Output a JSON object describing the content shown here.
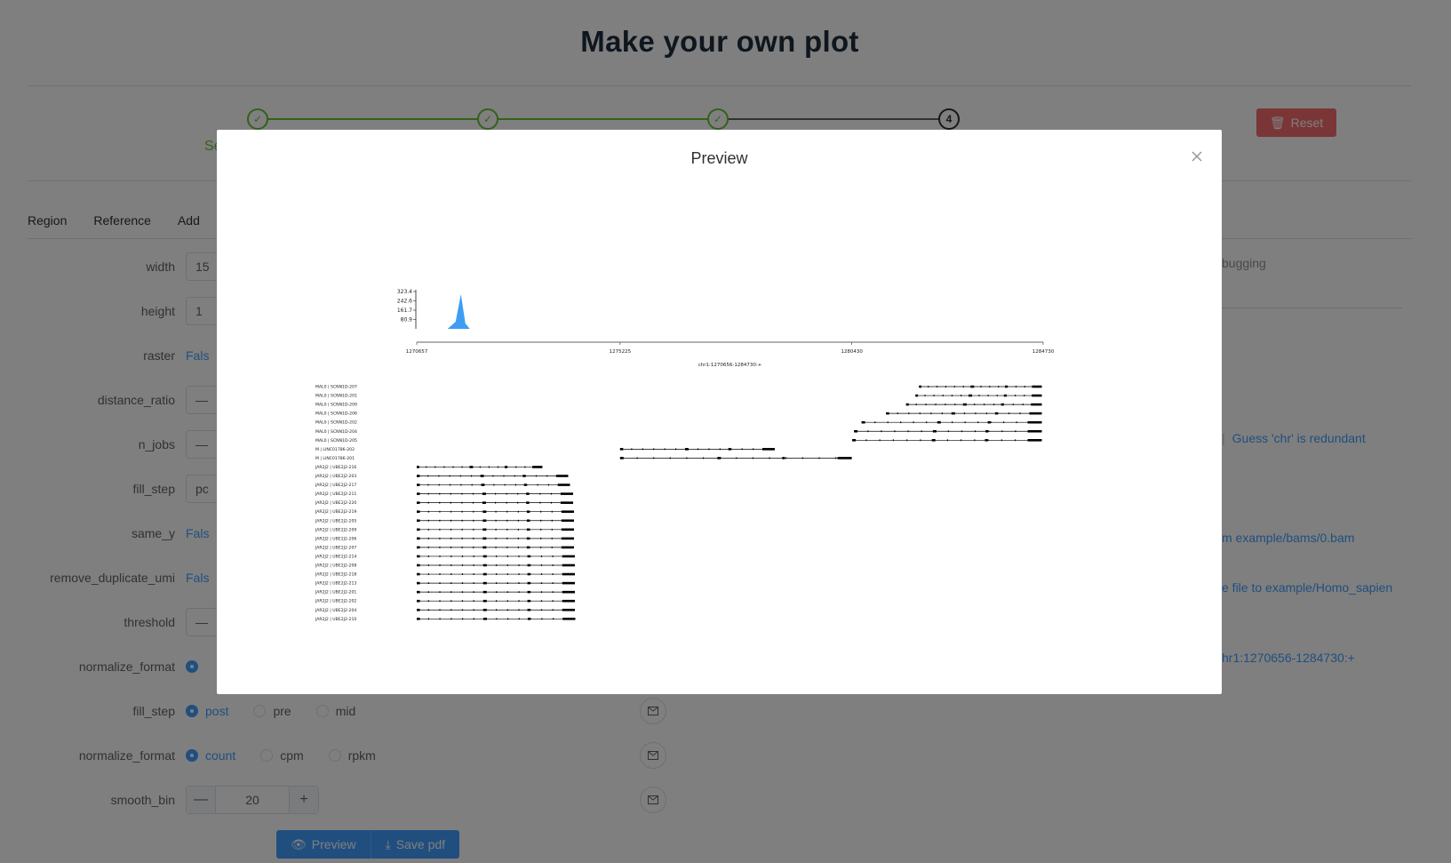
{
  "page": {
    "title": "Make your own plot",
    "step_label_partial": "Se",
    "current_step_number": "4",
    "reset_label": "Reset"
  },
  "tabs": [
    "Region",
    "Reference",
    "Add"
  ],
  "form": {
    "width": {
      "label": "width",
      "value": "15"
    },
    "height": {
      "label": "height",
      "value": "1"
    },
    "raster": {
      "label": "raster",
      "value": "Fals"
    },
    "distance_ratio": {
      "label": "distance_ratio",
      "value": "—"
    },
    "n_jobs": {
      "label": "n_jobs",
      "value": "—"
    },
    "fill_step_top": {
      "label": "fill_step",
      "value": "pc"
    },
    "same_y": {
      "label": "same_y",
      "value": "Fals"
    },
    "remove_duplicate_umi": {
      "label": "remove_duplicate_umi",
      "value": "Fals"
    },
    "threshold": {
      "label": "threshold",
      "value": "—"
    },
    "normalize_format_top": {
      "label": "normalize_format"
    },
    "fill_step": {
      "label": "fill_step",
      "options": [
        "post",
        "pre",
        "mid"
      ],
      "selected": "post"
    },
    "normalize_format": {
      "label": "normalize_format",
      "options": [
        "count",
        "cpm",
        "rpkm"
      ],
      "selected": "count"
    },
    "smooth_bin": {
      "label": "smooth_bin",
      "value": "20",
      "minus": "—",
      "plus": "+"
    }
  },
  "buttons": {
    "preview": "Preview",
    "save_pdf": "Save pdf"
  },
  "right_panel": {
    "debugging": "bugging",
    "guess_chr": "Guess 'chr' is redundant",
    "bam": "m example/bams/0.bam",
    "reference": "e file to example/Homo_sapien",
    "region": "hr1:1270656-1284730:+"
  },
  "modal": {
    "title": "Preview",
    "close_icon": "close-icon"
  },
  "chart_data": {
    "type": "area",
    "title": "",
    "xlabel": "chr1:1270656-1284730:+",
    "ylabel": "",
    "y_ticks": [
      "323.4",
      "242.6",
      "161.7",
      "80.9"
    ],
    "x_ticks": [
      "1270657",
      "1275225",
      "1280430",
      "1284730"
    ],
    "xlim": [
      1270657,
      1284730
    ],
    "ylim": [
      0,
      323.4
    ],
    "coverage_peak": {
      "x_start": 1271350,
      "x_peak": 1271650,
      "x_end": 1271850,
      "y_peak": 323.4
    },
    "transcripts": [
      {
        "name": "MAL0 | SCNN1D-207",
        "start": 1281940,
        "end": 1284700
      },
      {
        "name": "MAL0 | SCNN1D-201",
        "start": 1281860,
        "end": 1284700
      },
      {
        "name": "MAL0 | SCNN1D-209",
        "start": 1281650,
        "end": 1284700
      },
      {
        "name": "MAL0 | SCNN1D-206",
        "start": 1281200,
        "end": 1284700
      },
      {
        "name": "MAL0 | SCNN1D-202",
        "start": 1280650,
        "end": 1284700
      },
      {
        "name": "MAL0 | SCNN1D-204",
        "start": 1280480,
        "end": 1284700
      },
      {
        "name": "MAL0 | SCNN1D-205",
        "start": 1280440,
        "end": 1284700
      },
      {
        "name": "M | LINC01786-202",
        "start": 1275225,
        "end": 1278700
      },
      {
        "name": "M | LINC01786-201",
        "start": 1275225,
        "end": 1280430
      },
      {
        "name": "JAR2J2 | UBE2J2-216",
        "start": 1270657,
        "end": 1273480
      },
      {
        "name": "JAR2J2 | UBE2J2-203",
        "start": 1270657,
        "end": 1274060
      },
      {
        "name": "JAR2J2 | UBE2J2-217",
        "start": 1270657,
        "end": 1274100
      },
      {
        "name": "JAR2J2 | UBE2J2-211",
        "start": 1270657,
        "end": 1274170
      },
      {
        "name": "JAR2J2 | UBE2J2-220",
        "start": 1270657,
        "end": 1274170
      },
      {
        "name": "JAR2J2 | UBE2J2-219",
        "start": 1270657,
        "end": 1274190
      },
      {
        "name": "JAR2J2 | UBE2J2-205",
        "start": 1270657,
        "end": 1274190
      },
      {
        "name": "JAR2J2 | UBE2J2-209",
        "start": 1270657,
        "end": 1274190
      },
      {
        "name": "JAR2J2 | UBE2J2-206",
        "start": 1270657,
        "end": 1274190
      },
      {
        "name": "JAR2J2 | UBE2J2-207",
        "start": 1270657,
        "end": 1274190
      },
      {
        "name": "JAR2J2 | UBE2J2-214",
        "start": 1270657,
        "end": 1274210
      },
      {
        "name": "JAR2J2 | UBE2J2-208",
        "start": 1270657,
        "end": 1274210
      },
      {
        "name": "JAR2J2 | UBE2J2-218",
        "start": 1270657,
        "end": 1274210
      },
      {
        "name": "JAR2J2 | UBE2J2-213",
        "start": 1270657,
        "end": 1274210
      },
      {
        "name": "JAR2J2 | UBE2J2-201",
        "start": 1270657,
        "end": 1274210
      },
      {
        "name": "JAR2J2 | UBE2J2-202",
        "start": 1270657,
        "end": 1274210
      },
      {
        "name": "JAR2J2 | UBE2J2-204",
        "start": 1270657,
        "end": 1274210
      },
      {
        "name": "JAR2J2 | UBE2J2-210",
        "start": 1270657,
        "end": 1274220
      }
    ],
    "colors": {
      "coverage": "#3d9df3",
      "transcript": "#000000"
    }
  }
}
